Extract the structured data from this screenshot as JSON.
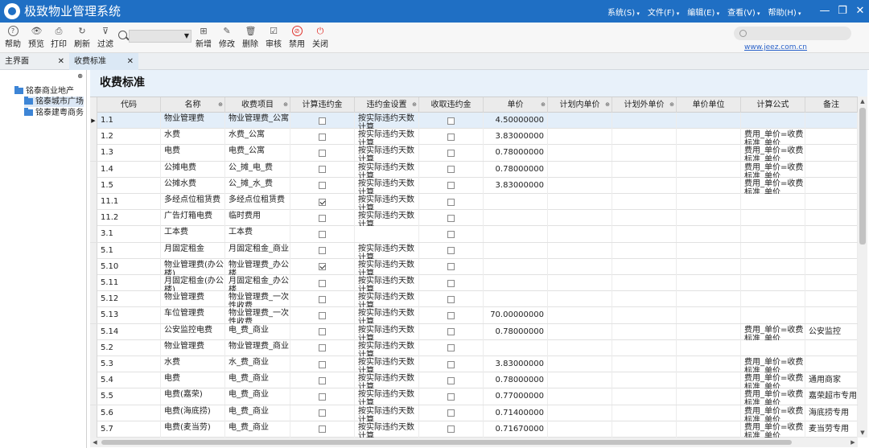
{
  "app": {
    "title": "极致物业管理系统"
  },
  "menus": [
    "系统(S)",
    "文件(F)",
    "编辑(E)",
    "查看(V)",
    "帮助(H)"
  ],
  "window_controls": [
    "—",
    "❐",
    "✕"
  ],
  "toolbar": {
    "help": "帮助",
    "preview": "预览",
    "print": "打印",
    "refresh": "刷新",
    "filter": "过滤",
    "add": "新增",
    "edit": "修改",
    "delete": "删除",
    "audit": "审核",
    "disable": "禁用",
    "close": "关闭",
    "search_value": "",
    "web_search_value": "",
    "website": "www.jeez.com.cn"
  },
  "tabs": [
    {
      "label": "主界面",
      "close": "✕"
    },
    {
      "label": "收费标准",
      "close": "✕"
    }
  ],
  "tree": {
    "pin": "⊕",
    "root": "铭泰商业地产",
    "children": [
      "铭泰城市广场",
      "铭泰建粤商务"
    ]
  },
  "page": {
    "title": "收费标准"
  },
  "grid": {
    "columns": [
      "代码",
      "名称",
      "收费项目",
      "计算违约金",
      "违约金设置",
      "收取违约金",
      "单价",
      "计划内单价",
      "计划外单价",
      "单价单位",
      "计算公式",
      "备注"
    ],
    "rows": [
      {
        "code": "1.1",
        "name": "物业管理费",
        "item": "物业管理费_公寓",
        "calc_penalty": false,
        "penalty_setting": "按实际违约天数计算",
        "collect_penalty": false,
        "price": "4.50000000",
        "formula": "",
        "note": ""
      },
      {
        "code": "1.2",
        "name": "水费",
        "item": "水费_公寓",
        "calc_penalty": false,
        "penalty_setting": "按实际违约天数计算",
        "collect_penalty": false,
        "price": "3.83000000",
        "formula": "费用_单价=收费标准_单价",
        "note": ""
      },
      {
        "code": "1.3",
        "name": "电费",
        "item": "电费_公寓",
        "calc_penalty": false,
        "penalty_setting": "按实际违约天数计算",
        "collect_penalty": false,
        "price": "0.78000000",
        "formula": "费用_单价=收费标准_单价",
        "note": ""
      },
      {
        "code": "1.4",
        "name": "公摊电费",
        "item": "公_摊_电_费",
        "calc_penalty": false,
        "penalty_setting": "按实际违约天数计算",
        "collect_penalty": false,
        "price": "0.78000000",
        "formula": "费用_单价=收费标准_单价",
        "note": ""
      },
      {
        "code": "1.5",
        "name": "公摊水费",
        "item": "公_摊_水_费",
        "calc_penalty": false,
        "penalty_setting": "按实际违约天数计算",
        "collect_penalty": false,
        "price": "3.83000000",
        "formula": "费用_单价=收费标准_单价",
        "note": ""
      },
      {
        "code": "11.1",
        "name": "多经点位租赁费",
        "item": "多经点位租赁费",
        "calc_penalty": true,
        "penalty_setting": "按实际违约天数计算",
        "collect_penalty": false,
        "price": "",
        "formula": "",
        "note": ""
      },
      {
        "code": "11.2",
        "name": "广告灯箱电费",
        "item": "临时费用",
        "calc_penalty": false,
        "penalty_setting": "按实际违约天数计算",
        "collect_penalty": false,
        "price": "",
        "formula": "",
        "note": ""
      },
      {
        "code": "3.1",
        "name": "工本费",
        "item": "工本费",
        "calc_penalty": false,
        "penalty_setting": "",
        "collect_penalty": false,
        "price": "",
        "formula": "",
        "note": ""
      },
      {
        "code": "5.1",
        "name": "月固定租金",
        "item": "月固定租金_商业",
        "calc_penalty": false,
        "penalty_setting": "按实际违约天数计算",
        "collect_penalty": false,
        "price": "",
        "formula": "",
        "note": ""
      },
      {
        "code": "5.10",
        "name": "物业管理费(办公楼)",
        "item": "物业管理费_办公楼",
        "calc_penalty": true,
        "penalty_setting": "按实际违约天数计算",
        "collect_penalty": false,
        "price": "",
        "formula": "",
        "note": ""
      },
      {
        "code": "5.11",
        "name": "月固定租金(办公楼)",
        "item": "月固定租金_办公楼",
        "calc_penalty": false,
        "penalty_setting": "按实际违约天数计算",
        "collect_penalty": false,
        "price": "",
        "formula": "",
        "note": ""
      },
      {
        "code": "5.12",
        "name": "物业管理费",
        "item": "物业管理费_一次性收费",
        "calc_penalty": false,
        "penalty_setting": "按实际违约天数计算",
        "collect_penalty": false,
        "price": "",
        "formula": "",
        "note": ""
      },
      {
        "code": "5.13",
        "name": "车位管理费",
        "item": "物业管理费_一次性收费",
        "calc_penalty": false,
        "penalty_setting": "按实际违约天数计算",
        "collect_penalty": false,
        "price": "70.00000000",
        "formula": "",
        "note": ""
      },
      {
        "code": "5.14",
        "name": "公安监控电费",
        "item": "电_费_商业",
        "calc_penalty": false,
        "penalty_setting": "按实际违约天数计算",
        "collect_penalty": false,
        "price": "0.78000000",
        "formula": "费用_单价=收费标准_单价",
        "note": "公安监控"
      },
      {
        "code": "5.2",
        "name": "物业管理费",
        "item": "物业管理费_商业",
        "calc_penalty": false,
        "penalty_setting": "按实际违约天数计算",
        "collect_penalty": false,
        "price": "",
        "formula": "",
        "note": ""
      },
      {
        "code": "5.3",
        "name": "水费",
        "item": "水_费_商业",
        "calc_penalty": false,
        "penalty_setting": "按实际违约天数计算",
        "collect_penalty": false,
        "price": "3.83000000",
        "formula": "费用_单价=收费标准_单价",
        "note": ""
      },
      {
        "code": "5.4",
        "name": "电费",
        "item": "电_费_商业",
        "calc_penalty": false,
        "penalty_setting": "按实际违约天数计算",
        "collect_penalty": false,
        "price": "0.78000000",
        "formula": "费用_单价=收费标准_单价",
        "note": "通用商家"
      },
      {
        "code": "5.5",
        "name": "电费(嘉荣)",
        "item": "电_费_商业",
        "calc_penalty": false,
        "penalty_setting": "按实际违约天数计算",
        "collect_penalty": false,
        "price": "0.77000000",
        "formula": "费用_单价=收费标准_单价",
        "note": "嘉荣超市专用"
      },
      {
        "code": "5.6",
        "name": "电费(海底捞)",
        "item": "电_费_商业",
        "calc_penalty": false,
        "penalty_setting": "按实际违约天数计算",
        "collect_penalty": false,
        "price": "0.71400000",
        "formula": "费用_单价=收费标准_单价",
        "note": "海底捞专用"
      },
      {
        "code": "5.7",
        "name": "电费(麦当劳)",
        "item": "电_费_商业",
        "calc_penalty": false,
        "penalty_setting": "按实际违约天数计算",
        "collect_penalty": false,
        "price": "0.71670000",
        "formula": "费用_单价=收费标准_单价",
        "note": "麦当劳专用"
      }
    ]
  },
  "colors": {
    "titlebar": "#1f6fc4",
    "accent": "#3d85d6",
    "selected_row": "#e3eef9"
  }
}
